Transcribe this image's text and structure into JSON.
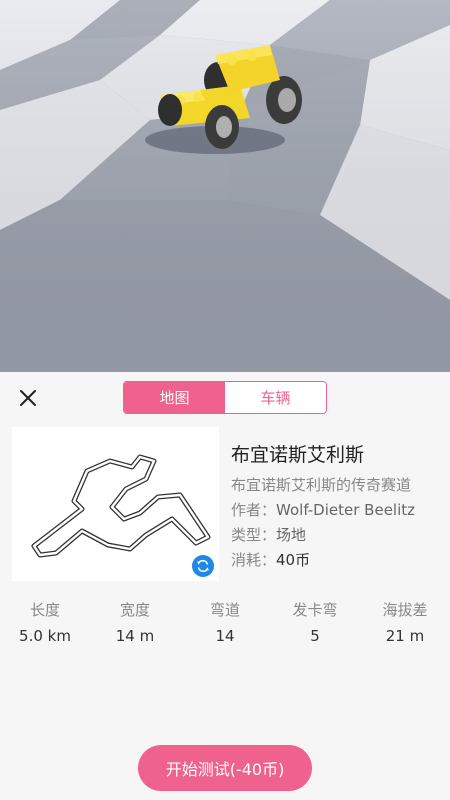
{
  "scene": {
    "subject": "yellow-lego-kart-3d-preview"
  },
  "sheet": {
    "tabs": [
      {
        "label": "地图",
        "active": true
      },
      {
        "label": "车辆",
        "active": false
      }
    ],
    "track": {
      "name": "布宜诺斯艾利斯",
      "description": "布宜诺斯艾利斯的传奇赛道",
      "author_label": "作者：",
      "author": "Wolf-Dieter Beelitz",
      "type_label": "类型：",
      "type": "场地",
      "cost_label": "消耗：",
      "cost": "40币"
    },
    "stats": [
      {
        "label": "长度",
        "value": "5.0 km"
      },
      {
        "label": "宽度",
        "value": "14 m"
      },
      {
        "label": "弯道",
        "value": "14"
      },
      {
        "label": "发卡弯",
        "value": "5"
      },
      {
        "label": "海拔差",
        "value": "21 m"
      }
    ],
    "start_label": "开始测试(-40币)"
  },
  "colors": {
    "accent": "#f0628e",
    "refresh": "#1e88e5"
  }
}
